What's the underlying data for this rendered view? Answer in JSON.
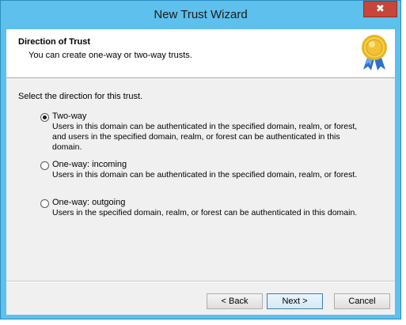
{
  "window": {
    "title": "New Trust Wizard"
  },
  "titlebar": {
    "close_glyph": "✖"
  },
  "header": {
    "title": "Direction of Trust",
    "subtitle": "You can create one-way or two-way trusts.",
    "icon": "award-medal-icon"
  },
  "content": {
    "prompt": "Select the direction for this trust.",
    "options": [
      {
        "label": "Two-way",
        "description": "Users in this domain can be authenticated in the specified domain, realm, or forest, and users in the specified domain, realm, or forest can be authenticated in this domain.",
        "checked": true
      },
      {
        "label": "One-way: incoming",
        "description": "Users in this domain can be authenticated in the specified domain, realm, or forest.",
        "checked": false
      },
      {
        "label": "One-way: outgoing",
        "description": "Users in the specified domain, realm, or forest can be authenticated in this domain.",
        "checked": false
      }
    ]
  },
  "buttons": {
    "back": "< Back",
    "next": "Next >",
    "cancel": "Cancel"
  },
  "colors": {
    "titlebar": "#5ec0ec",
    "close": "#c7463a",
    "client": "#f0f0f0"
  }
}
